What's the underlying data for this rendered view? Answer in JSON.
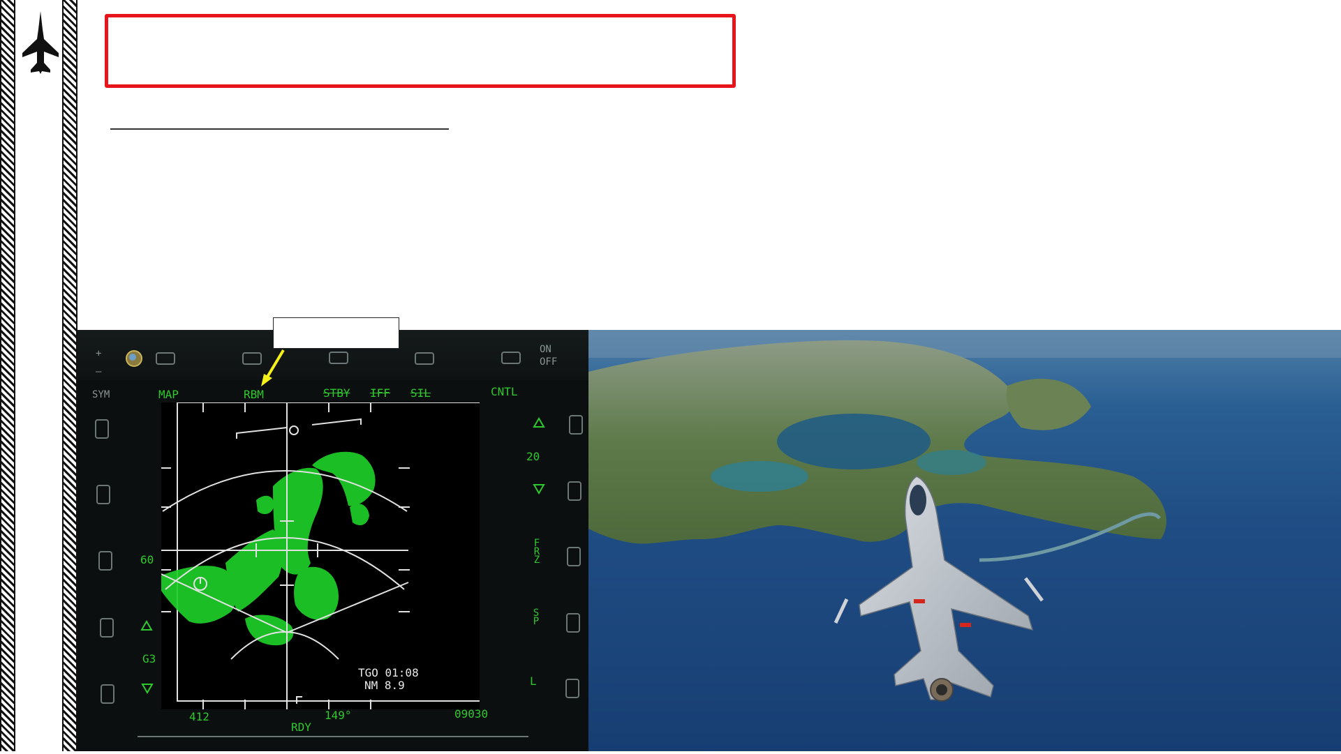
{
  "title_box": {
    "text": ""
  },
  "colors": {
    "title_border": "#e8141b",
    "radar_green": "#2ec92e",
    "callout_arrow": "#f5f21a",
    "sea": "#1f4d84"
  },
  "logo": {
    "icon": "fighter-jet-silhouette-icon"
  },
  "callout": {
    "text": ""
  },
  "mfd": {
    "top_osb": {
      "sym": "SYM",
      "map": "MAP",
      "rbm": "RBM",
      "stby": "STBY",
      "iff": "IFF",
      "sil": "SIL",
      "cntl": "CNTL",
      "on": "ON",
      "off": "OFF",
      "plus": "+",
      "minus": "–"
    },
    "left_osb": {
      "range_60": "60",
      "gain": "G3"
    },
    "right_osb": {
      "value_20": "20",
      "frz": "FRZ",
      "sp": "SP",
      "l": "L"
    },
    "screen": {
      "tgo": "TGO 01:08",
      "nm": "NM  8.9",
      "bottom_left": "412",
      "heading": "149°",
      "bottom_right": "09030",
      "status": "RDY"
    }
  },
  "photo": {
    "subject": "J-10 fighter over coastal island"
  }
}
